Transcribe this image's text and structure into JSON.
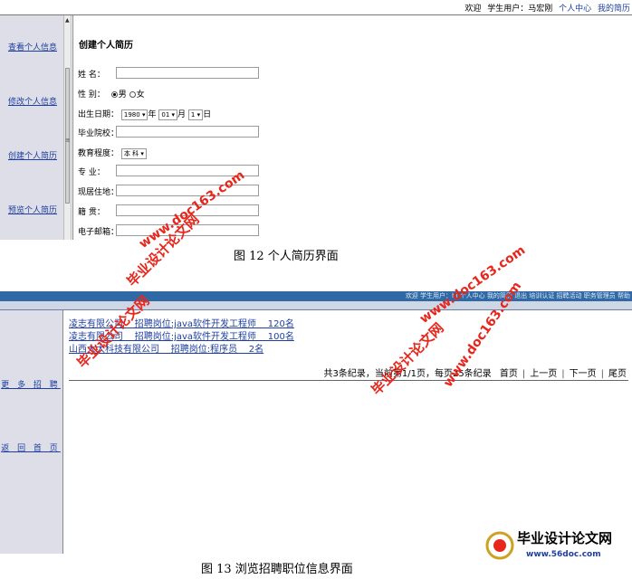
{
  "fig12": {
    "top_links": {
      "welcome": "欢迎",
      "user": "学生用户：马宏刚",
      "center": "个人中心",
      "my_jobs": "我的简历"
    },
    "nav": [
      "查看个人信息",
      "修改个人信息",
      "创建个人简历",
      "预览个人简历"
    ],
    "form_title": "创建个人简历",
    "fields": {
      "name": "姓 名：",
      "gender": "性 别：",
      "male": "男",
      "female": "女",
      "birth": "出生日期：",
      "birth_year": "1980",
      "year_unit": "年",
      "birth_month": "01",
      "month_unit": "月",
      "birth_day": "1",
      "day_unit": "日",
      "school": "毕业院校：",
      "education": "教育程度：",
      "education_value": "本 科",
      "major": "专 业：",
      "address": "现居住地：",
      "hometown": "籍 贯：",
      "email": "电子邮箱："
    },
    "caption": "图 12 个人简历界面"
  },
  "fig13": {
    "header_text": "欢迎 学生用户：hi 个人中心 我的简历 退出 培训认证 招聘活动 职务管理员 帮助",
    "nav": [
      "更 多 招 聘",
      "返 回 首 页"
    ],
    "jobs": [
      "凌志有限公司    招聘岗位:java软件开发工程师    120名",
      "凌志有限公司    招聘岗位:java软件开发工程师    100名",
      "山西大大科技有限公司    招聘岗位:程序员    2名"
    ],
    "pager": {
      "summary": "共3条纪录，当前第1/1页，每页25条纪录",
      "first": "首页",
      "prev": "上一页",
      "next": "下一页",
      "last": "尾页"
    },
    "caption": "图 13 浏览招聘职位信息界面"
  },
  "watermarks": {
    "cn": "毕业设计论文网",
    "url": "www.doc163.com",
    "logo_cn": "毕业设计论文网",
    "logo_url": "www.56doc.com"
  },
  "colors": {
    "link": "#1d3fa0",
    "sidebar": "#dedee8",
    "header_bar": "#2f6aa6",
    "watermark": "#e8261c"
  }
}
